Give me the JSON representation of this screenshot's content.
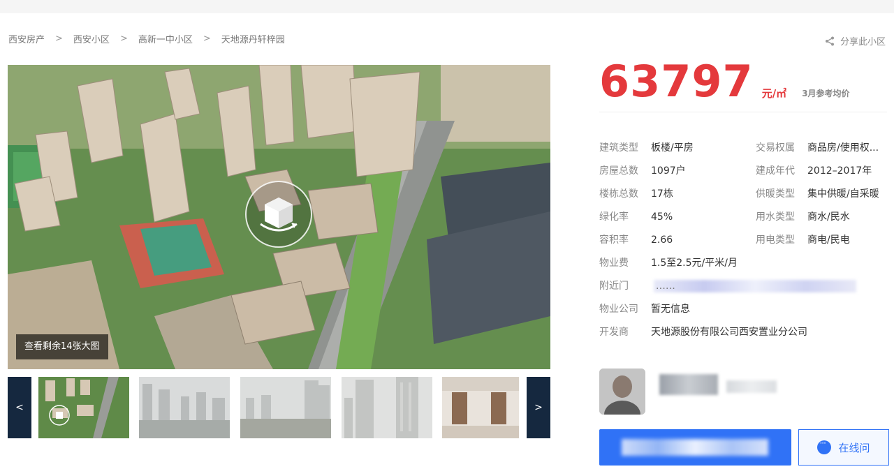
{
  "breadcrumb": {
    "items": [
      "西安房产",
      "西安小区",
      "高新一中小区",
      "天地源丹轩梓园"
    ],
    "separator": ">"
  },
  "share": {
    "label": "分享此小区",
    "icon": "share-icon"
  },
  "gallery": {
    "view_more_label": "查看剩余14张大图",
    "prev_label": "<",
    "next_label": ">",
    "vr_icon": "3d-cube-icon"
  },
  "price": {
    "value": "63797",
    "unit": "元/㎡",
    "note": "3月参考均价",
    "color": "#e4393c"
  },
  "info": [
    {
      "key": "建筑类型",
      "value": "板楼/平房"
    },
    {
      "key": "交易权属",
      "value": "商品房/使用权..."
    },
    {
      "key": "房屋总数",
      "value": "1097户"
    },
    {
      "key": "建成年代",
      "value": "2012–2017年"
    },
    {
      "key": "楼栋总数",
      "value": "17栋"
    },
    {
      "key": "供暖类型",
      "value": "集中供暖/自采暖"
    },
    {
      "key": "绿化率",
      "value": "45%"
    },
    {
      "key": "用水类型",
      "value": "商水/民水"
    },
    {
      "key": "容积率",
      "value": "2.66"
    },
    {
      "key": "用电类型",
      "value": "商电/民电"
    },
    {
      "key": "物业费",
      "value": "1.5至2.5元/平米/月"
    },
    {
      "key": "附近门",
      "value": "……"
    },
    {
      "key": "物业公司",
      "value": "暂无信息"
    },
    {
      "key": "开发商",
      "value": "天地源股份有限公司西安置业分公司"
    }
  ],
  "chat": {
    "label": "在线问",
    "icon": "chat-bubble-icon"
  },
  "accent_color": "#3072f6"
}
